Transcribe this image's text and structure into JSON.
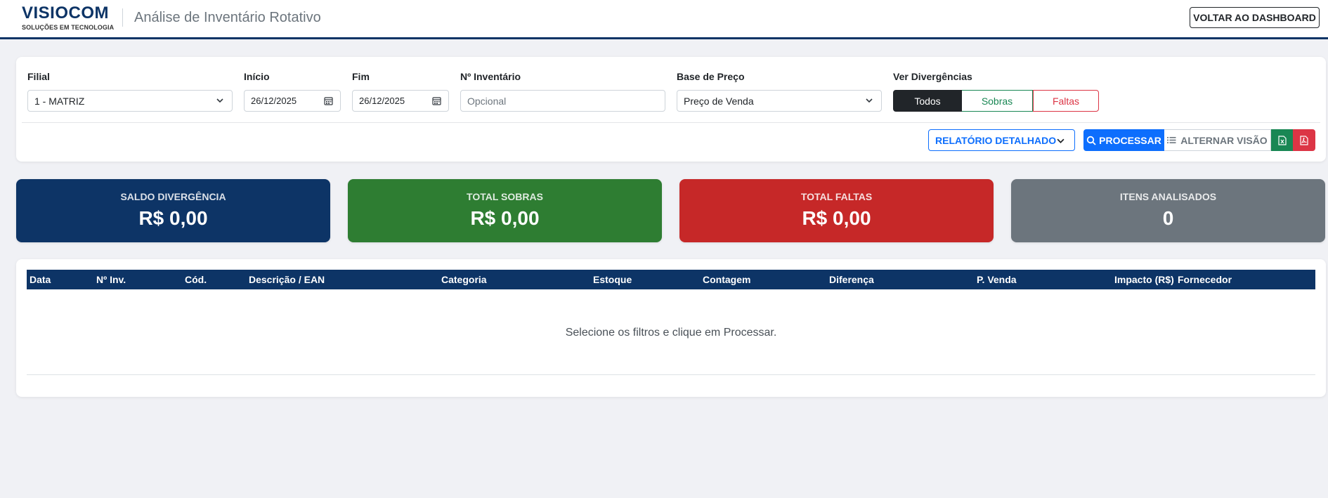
{
  "header": {
    "brand_name": "VISIOCOM",
    "brand_sub": "SOLUÇÕES EM TECNOLOGIA",
    "title": "Análise de Inventário Rotativo",
    "dashboard_button": "VOLTAR AO DASHBOARD"
  },
  "filters": {
    "filial": {
      "label": "Filial",
      "value": "1 - MATRIZ"
    },
    "inicio": {
      "label": "Início",
      "value": "26/12/2025"
    },
    "fim": {
      "label": "Fim",
      "value": "26/12/2025"
    },
    "inventario": {
      "label": "Nº Inventário",
      "placeholder": "Opcional",
      "value": ""
    },
    "base_preco": {
      "label": "Base de Preço",
      "value": "Preço de Venda"
    },
    "divergencias": {
      "label": "Ver Divergências",
      "options": [
        "Todos",
        "Sobras",
        "Faltas"
      ],
      "selected": "Todos"
    }
  },
  "actions": {
    "relatorio": "RELATÓRIO DETALHADO",
    "processar": "PROCESSAR",
    "alternar": "ALTERNAR VISÃO"
  },
  "kpis": [
    {
      "label": "SALDO DIVERGÊNCIA",
      "value": "R$ 0,00",
      "color": "#0d3466"
    },
    {
      "label": "TOTAL SOBRAS",
      "value": "R$ 0,00",
      "color": "#2e7d32"
    },
    {
      "label": "TOTAL FALTAS",
      "value": "R$ 0,00",
      "color": "#c62828"
    },
    {
      "label": "ITENS ANALISADOS",
      "value": "0",
      "color": "#6c757d"
    }
  ],
  "table": {
    "columns": [
      "Data",
      "Nº Inv.",
      "Cód.",
      "Descrição / EAN",
      "Categoria",
      "Estoque",
      "Contagem",
      "Diferença",
      "P. Venda",
      "Impacto (R$)",
      "Fornecedor"
    ],
    "empty_message": "Selecione os filtros e clique em Processar."
  },
  "colors": {
    "primary": "#0d3466",
    "accent": "#0d6efd",
    "success": "#198754",
    "danger": "#dc3545"
  }
}
